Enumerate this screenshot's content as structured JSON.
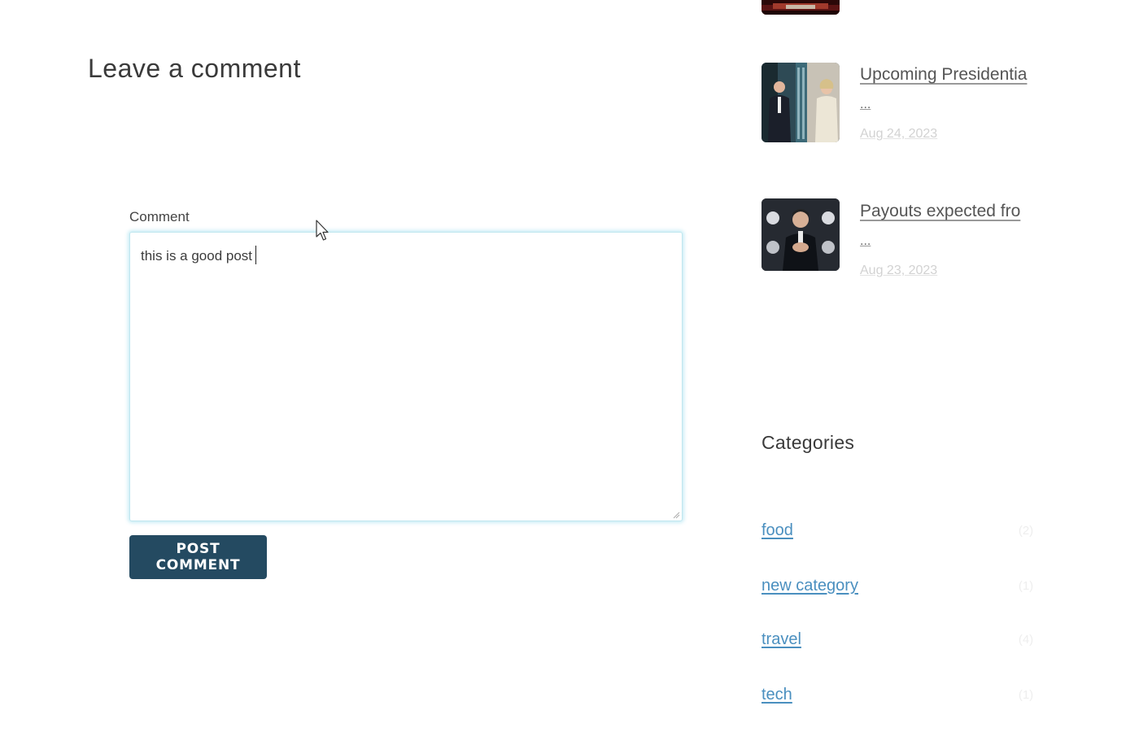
{
  "comment_form": {
    "heading": "Leave a comment",
    "label": "Comment",
    "value": "this is a good post",
    "submit_label": "POST COMMENT"
  },
  "recent_posts": [
    {
      "title": "Upcoming Presidentia",
      "ellipsis": "...",
      "date": "Aug 24, 2023"
    },
    {
      "title": "Payouts expected fro",
      "ellipsis": "...",
      "date": "Aug 23, 2023"
    }
  ],
  "categories": {
    "heading": "Categories",
    "items": [
      {
        "label": "food",
        "count": "(2)"
      },
      {
        "label": "new category",
        "count": "(1)"
      },
      {
        "label": "travel",
        "count": "(4)"
      },
      {
        "label": "tech",
        "count": "(1)"
      }
    ]
  },
  "colors": {
    "button_bg": "#244a61",
    "link": "#4a8fbf",
    "focus_glow": "#bfe6ef"
  }
}
